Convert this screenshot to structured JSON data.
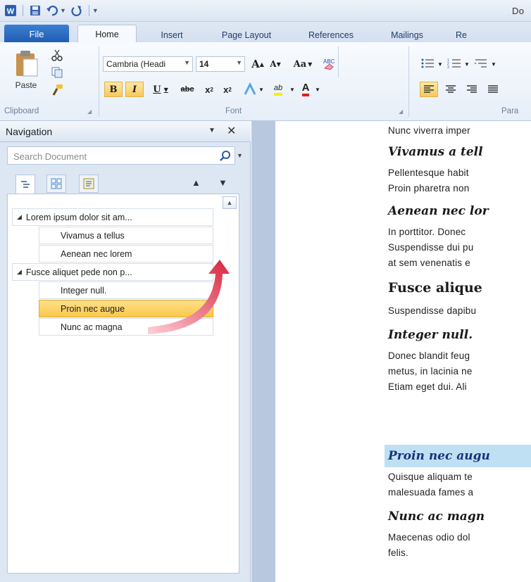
{
  "window": {
    "title": "Do"
  },
  "quick_access": {
    "icons": [
      "word-icon",
      "save-icon",
      "undo-icon",
      "redo-icon",
      "customize-icon"
    ]
  },
  "tabs": [
    {
      "label": "File"
    },
    {
      "label": "Home"
    },
    {
      "label": "Insert"
    },
    {
      "label": "Page Layout"
    },
    {
      "label": "References"
    },
    {
      "label": "Mailings"
    },
    {
      "label": "Re"
    }
  ],
  "ribbon": {
    "clipboard": {
      "paste_label": "Paste",
      "group_label": "Clipboard"
    },
    "font": {
      "font_name": "Cambria (Headi",
      "font_size": "14",
      "grow_font": "A",
      "shrink_font": "A",
      "change_case": "Aa",
      "bold": "B",
      "italic": "I",
      "underline": "U",
      "strikethrough": "abc",
      "subscript": "x",
      "superscript": "x",
      "highlight": "ab",
      "font_color": "A",
      "group_label": "Font"
    },
    "paragraph": {
      "group_label": "Para"
    }
  },
  "navigation": {
    "title": "Navigation",
    "search_placeholder": "Search Document",
    "items": [
      {
        "label": "Lorem ipsum dolor sit am...",
        "level": 1,
        "selected": false
      },
      {
        "label": "Vivamus a tellus",
        "level": 2,
        "selected": false
      },
      {
        "label": "Aenean nec lorem",
        "level": 2,
        "selected": false
      },
      {
        "label": "Fusce aliquet pede non p...",
        "level": 1,
        "selected": false
      },
      {
        "label": "Integer null.",
        "level": 2,
        "selected": false
      },
      {
        "label": "Proin nec augue",
        "level": 2,
        "selected": true
      },
      {
        "label": "Nunc ac magna",
        "level": 2,
        "selected": false
      }
    ]
  },
  "document": {
    "lines": [
      {
        "type": "body",
        "text": "Nunc viverra imper"
      },
      {
        "type": "h2",
        "text": "Vivamus a tell"
      },
      {
        "type": "body",
        "text": "Pellentesque habit"
      },
      {
        "type": "body",
        "text": "Proin pharetra non"
      },
      {
        "type": "h2",
        "text": "Aenean nec lor"
      },
      {
        "type": "body",
        "text": "In porttitor.  Donec"
      },
      {
        "type": "body",
        "text": "Suspendisse dui pu"
      },
      {
        "type": "body",
        "text": "at sem venenatis e"
      },
      {
        "type": "h1",
        "text": "Fusce alique"
      },
      {
        "type": "body",
        "text": "Suspendisse dapibu"
      },
      {
        "type": "h2",
        "text": "Integer null."
      },
      {
        "type": "body",
        "text": "Donec blandit feug"
      },
      {
        "type": "body",
        "text": "metus, in lacinia ne"
      },
      {
        "type": "body",
        "text": "Etiam eget dui. Ali"
      },
      {
        "type": "h2-highlight",
        "text": "Proin nec augu"
      },
      {
        "type": "body",
        "text": "Quisque aliquam te"
      },
      {
        "type": "body",
        "text": "malesuada fames a"
      },
      {
        "type": "h2",
        "text": "Nunc ac magn"
      },
      {
        "type": "body",
        "text": "Maecenas odio dol"
      },
      {
        "type": "body",
        "text": "felis."
      }
    ]
  },
  "colors": {
    "file_tab": "#1e5cb3",
    "selected_item": "#f9c94a",
    "highlight_band": "#bfe0f3",
    "arrow": "#d8233b"
  }
}
